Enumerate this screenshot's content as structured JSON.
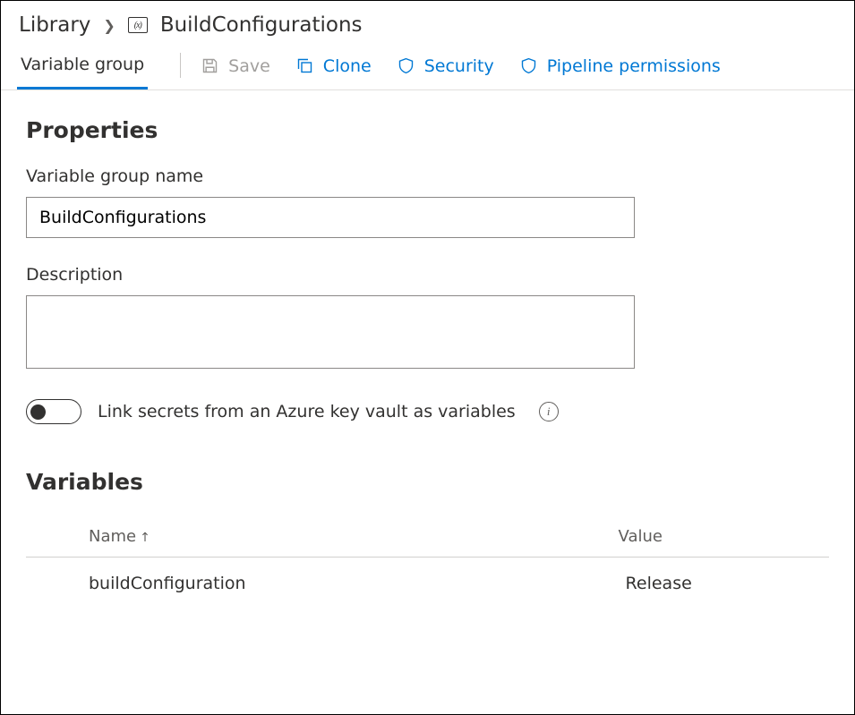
{
  "breadcrumb": {
    "library": "Library",
    "title": "BuildConfigurations"
  },
  "toolbar": {
    "tab_label": "Variable group",
    "save": "Save",
    "clone": "Clone",
    "security": "Security",
    "pipeline_permissions": "Pipeline permissions"
  },
  "properties": {
    "heading": "Properties",
    "name_label": "Variable group name",
    "name_value": "BuildConfigurations",
    "desc_label": "Description",
    "desc_value": "",
    "toggle_label": "Link secrets from an Azure key vault as variables"
  },
  "variables": {
    "heading": "Variables",
    "col_name": "Name",
    "col_value": "Value",
    "rows": [
      {
        "name": "buildConfiguration",
        "value": "Release"
      }
    ]
  }
}
